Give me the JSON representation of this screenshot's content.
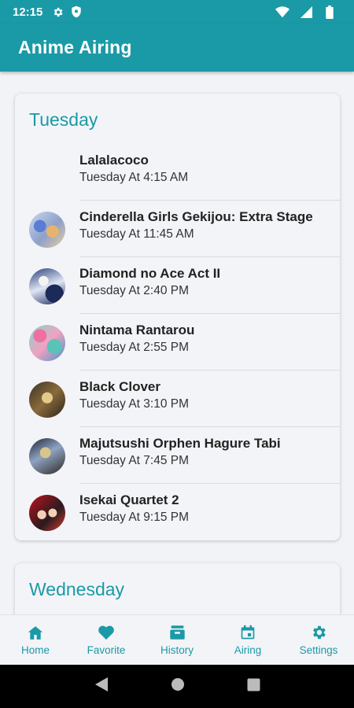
{
  "status_bar": {
    "time": "12:15"
  },
  "app_bar": {
    "title": "Anime Airing"
  },
  "days": [
    {
      "name": "Tuesday",
      "shows": [
        {
          "title": "Lalalacoco",
          "time": "Tuesday At 4:15 AM",
          "has_image": false
        },
        {
          "title": "Cinderella Girls Gekijou: Extra Stage",
          "time": "Tuesday At 11:45 AM",
          "has_image": true
        },
        {
          "title": "Diamond no Ace Act II",
          "time": "Tuesday At 2:40 PM",
          "has_image": true
        },
        {
          "title": "Nintama Rantarou",
          "time": "Tuesday At 2:55 PM",
          "has_image": true
        },
        {
          "title": "Black Clover",
          "time": "Tuesday At 3:10 PM",
          "has_image": true
        },
        {
          "title": "Majutsushi Orphen Hagure Tabi",
          "time": "Tuesday At 7:45 PM",
          "has_image": true
        },
        {
          "title": "Isekai Quartet 2",
          "time": "Tuesday At 9:15 PM",
          "has_image": true
        }
      ]
    },
    {
      "name": "Wednesday",
      "shows": []
    }
  ],
  "bottom_nav": [
    {
      "label": "Home",
      "icon": "home-icon",
      "active": false
    },
    {
      "label": "Favorite",
      "icon": "heart-icon",
      "active": false
    },
    {
      "label": "History",
      "icon": "inbox-icon",
      "active": false
    },
    {
      "label": "Airing",
      "icon": "calendar-icon",
      "active": true
    },
    {
      "label": "Settings",
      "icon": "gear-icon",
      "active": false
    }
  ],
  "colors": {
    "accent": "#1a9aa6",
    "background": "#f2f3f7",
    "text": "#222222"
  }
}
